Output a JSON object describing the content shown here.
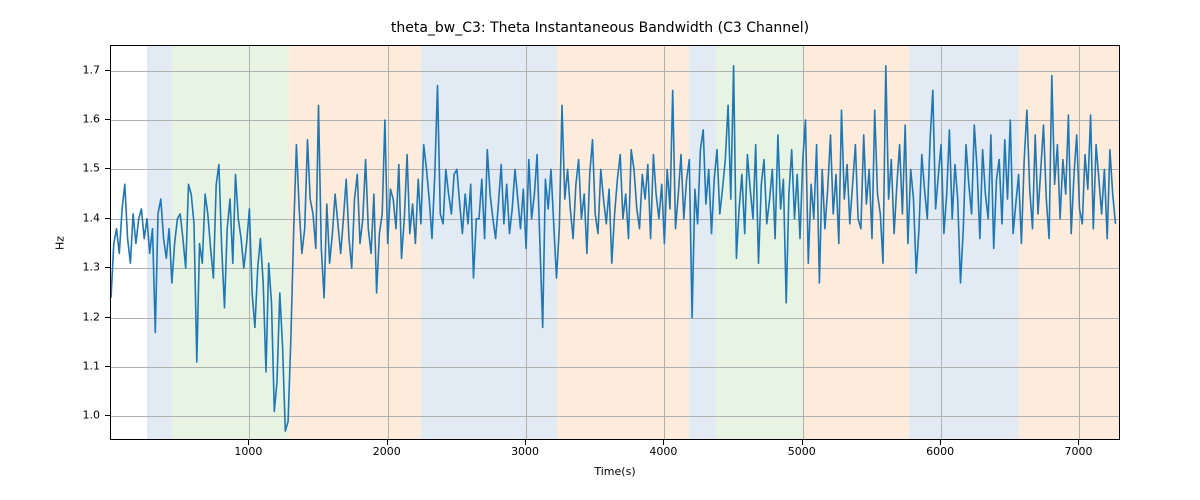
{
  "chart_data": {
    "type": "line",
    "title": "theta_bw_C3: Theta Instantaneous Bandwidth (C3 Channel)",
    "xlabel": "Time(s)",
    "ylabel": "Hz",
    "xlim": [
      0,
      7300
    ],
    "ylim": [
      0.95,
      1.75
    ],
    "xticks": [
      1000,
      2000,
      3000,
      4000,
      5000,
      6000,
      7000
    ],
    "yticks": [
      1.0,
      1.1,
      1.2,
      1.3,
      1.4,
      1.5,
      1.6,
      1.7
    ],
    "xtick_labels": [
      "1000",
      "2000",
      "3000",
      "4000",
      "5000",
      "6000",
      "7000"
    ],
    "ytick_labels": [
      "1.0",
      "1.1",
      "1.2",
      "1.3",
      "1.4",
      "1.5",
      "1.6",
      "1.7"
    ],
    "line_color": "#1f77b4",
    "bands": [
      {
        "start": 260,
        "end": 440,
        "color": "blue"
      },
      {
        "start": 440,
        "end": 1290,
        "color": "green"
      },
      {
        "start": 1290,
        "end": 2240,
        "color": "orange"
      },
      {
        "start": 2240,
        "end": 3090,
        "color": "blue"
      },
      {
        "start": 3090,
        "end": 3220,
        "color": "blue"
      },
      {
        "start": 3220,
        "end": 4180,
        "color": "orange"
      },
      {
        "start": 4180,
        "end": 4370,
        "color": "blue"
      },
      {
        "start": 4370,
        "end": 5000,
        "color": "green"
      },
      {
        "start": 5000,
        "end": 5770,
        "color": "orange"
      },
      {
        "start": 5770,
        "end": 6560,
        "color": "blue"
      },
      {
        "start": 6560,
        "end": 7300,
        "color": "orange"
      }
    ],
    "band_fill_opacity": 0.3,
    "series": [
      {
        "name": "theta_bw_C3",
        "x_step": 20,
        "values": [
          1.24,
          1.35,
          1.38,
          1.33,
          1.42,
          1.47,
          1.36,
          1.31,
          1.41,
          1.35,
          1.4,
          1.42,
          1.36,
          1.4,
          1.33,
          1.38,
          1.17,
          1.41,
          1.44,
          1.36,
          1.32,
          1.38,
          1.27,
          1.35,
          1.4,
          1.41,
          1.36,
          1.3,
          1.47,
          1.45,
          1.39,
          1.11,
          1.35,
          1.31,
          1.45,
          1.41,
          1.34,
          1.28,
          1.47,
          1.51,
          1.34,
          1.22,
          1.38,
          1.44,
          1.31,
          1.49,
          1.4,
          1.36,
          1.3,
          1.35,
          1.42,
          1.25,
          1.18,
          1.3,
          1.36,
          1.27,
          1.09,
          1.31,
          1.23,
          1.01,
          1.07,
          1.25,
          1.14,
          0.97,
          0.99,
          1.16,
          1.37,
          1.55,
          1.42,
          1.33,
          1.38,
          1.56,
          1.44,
          1.41,
          1.34,
          1.63,
          1.34,
          1.24,
          1.43,
          1.31,
          1.37,
          1.45,
          1.39,
          1.33,
          1.4,
          1.48,
          1.36,
          1.3,
          1.44,
          1.49,
          1.35,
          1.4,
          1.52,
          1.38,
          1.33,
          1.45,
          1.25,
          1.37,
          1.41,
          1.6,
          1.35,
          1.46,
          1.44,
          1.38,
          1.51,
          1.32,
          1.4,
          1.53,
          1.37,
          1.43,
          1.35,
          1.48,
          1.39,
          1.55,
          1.5,
          1.44,
          1.36,
          1.49,
          1.67,
          1.41,
          1.39,
          1.5,
          1.45,
          1.41,
          1.49,
          1.5,
          1.43,
          1.37,
          1.45,
          1.39,
          1.47,
          1.28,
          1.4,
          1.4,
          1.48,
          1.36,
          1.54,
          1.45,
          1.4,
          1.36,
          1.43,
          1.51,
          1.39,
          1.47,
          1.37,
          1.42,
          1.5,
          1.44,
          1.38,
          1.46,
          1.34,
          1.52,
          1.4,
          1.45,
          1.53,
          1.35,
          1.18,
          1.48,
          1.42,
          1.5,
          1.39,
          1.28,
          1.38,
          1.63,
          1.44,
          1.5,
          1.42,
          1.36,
          1.47,
          1.52,
          1.4,
          1.45,
          1.33,
          1.49,
          1.56,
          1.41,
          1.37,
          1.5,
          1.44,
          1.39,
          1.46,
          1.31,
          1.41,
          1.48,
          1.53,
          1.4,
          1.45,
          1.36,
          1.54,
          1.5,
          1.42,
          1.38,
          1.49,
          1.44,
          1.51,
          1.36,
          1.53,
          1.45,
          1.4,
          1.47,
          1.35,
          1.5,
          1.42,
          1.66,
          1.38,
          1.45,
          1.53,
          1.4,
          1.48,
          1.52,
          1.2,
          1.46,
          1.39,
          1.54,
          1.58,
          1.43,
          1.5,
          1.37,
          1.48,
          1.54,
          1.41,
          1.46,
          1.52,
          1.63,
          1.44,
          1.71,
          1.32,
          1.42,
          1.49,
          1.37,
          1.53,
          1.46,
          1.4,
          1.55,
          1.31,
          1.47,
          1.52,
          1.39,
          1.44,
          1.5,
          1.36,
          1.57,
          1.42,
          1.48,
          1.23,
          1.45,
          1.54,
          1.4,
          1.49,
          1.36,
          1.52,
          1.6,
          1.31,
          1.47,
          1.4,
          1.55,
          1.27,
          1.5,
          1.38,
          1.46,
          1.57,
          1.41,
          1.49,
          1.35,
          1.62,
          1.44,
          1.51,
          1.39,
          1.47,
          1.55,
          1.4,
          1.38,
          1.57,
          1.43,
          1.5,
          1.36,
          1.62,
          1.45,
          1.41,
          1.31,
          1.71,
          1.44,
          1.52,
          1.37,
          1.47,
          1.55,
          1.41,
          1.59,
          1.35,
          1.5,
          1.44,
          1.29,
          1.38,
          1.53,
          1.46,
          1.4,
          1.56,
          1.66,
          1.42,
          1.49,
          1.55,
          1.37,
          1.45,
          1.58,
          1.4,
          1.51,
          1.44,
          1.27,
          1.38,
          1.55,
          1.47,
          1.41,
          1.59,
          1.5,
          1.36,
          1.54,
          1.45,
          1.4,
          1.57,
          1.34,
          1.48,
          1.52,
          1.39,
          1.56,
          1.44,
          1.6,
          1.37,
          1.43,
          1.49,
          1.35,
          1.52,
          1.62,
          1.46,
          1.38,
          1.57,
          1.41,
          1.5,
          1.59,
          1.44,
          1.36,
          1.69,
          1.47,
          1.55,
          1.4,
          1.52,
          1.45,
          1.61,
          1.37,
          1.49,
          1.57,
          1.42,
          1.39,
          1.53,
          1.46,
          1.61,
          1.38,
          1.55,
          1.48,
          1.41,
          1.5,
          1.36,
          1.54,
          1.45,
          1.39
        ]
      }
    ],
    "n_points": 364
  }
}
